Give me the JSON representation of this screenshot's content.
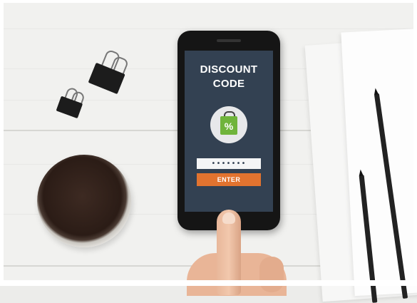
{
  "phone_screen": {
    "title_line1": "DISCOUNT",
    "title_line2": "CODE",
    "bag_symbol": "%",
    "code_value": "•••••••",
    "enter_label": "ENTER",
    "colors": {
      "screen_bg": "#334152",
      "button": "#e2732f",
      "bag": "#6fb43b"
    }
  },
  "scene": {
    "objects": [
      "binder-clip",
      "binder-clip",
      "coffee-cup",
      "smartphone",
      "paper-sheets",
      "pencil",
      "pencil",
      "hand"
    ]
  }
}
